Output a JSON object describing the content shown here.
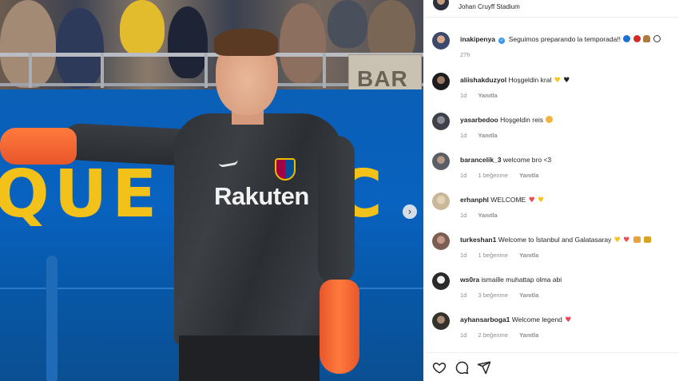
{
  "post": {
    "location": "Johan Cruyff Stadium",
    "photo": {
      "sign_text": "BAR",
      "wall_text": "QUE UN C",
      "sponsor_text": "Rakuten",
      "next_icon": "chevron-right-icon"
    }
  },
  "caption": {
    "user": "inakipenya",
    "text": "Seguimos preparando la temporada!!",
    "time": "27h"
  },
  "comments": [
    {
      "user": "aliishakduzyol",
      "text": "Hoşgeldin kral",
      "time": "1d",
      "likes": "",
      "reply": "Yanıtla"
    },
    {
      "user": "yasarbedoo",
      "text": "Hoşgeldin reis",
      "time": "1d",
      "likes": "",
      "reply": "Yanıtla"
    },
    {
      "user": "barancelik_3",
      "text": "welcome bro <3",
      "time": "1d",
      "likes": "1 beğenme",
      "reply": "Yanıtla"
    },
    {
      "user": "erhanphl",
      "text": "WELCOME",
      "time": "1d",
      "likes": "",
      "reply": "Yanıtla"
    },
    {
      "user": "turkeshan1",
      "text": "Welcome to İstanbul and Galatasaray",
      "time": "1d",
      "likes": "1 beğenme",
      "reply": "Yanıtla"
    },
    {
      "user": "ws0ra",
      "text": "ismaille muhattap olma abi",
      "time": "1d",
      "likes": "3 beğenme",
      "reply": "Yanıtla"
    },
    {
      "user": "ayhansarboga1",
      "text": "Welcome legend",
      "time": "1d",
      "likes": "2 beğenme",
      "reply": "Yanıtla"
    }
  ],
  "actions": {
    "like_icon": "heart-icon",
    "comment_icon": "comment-icon",
    "share_icon": "send-icon"
  },
  "colors": {
    "verified": "#3897f0",
    "heart": "#ed4956",
    "muted_text": "#8e8e8e"
  }
}
